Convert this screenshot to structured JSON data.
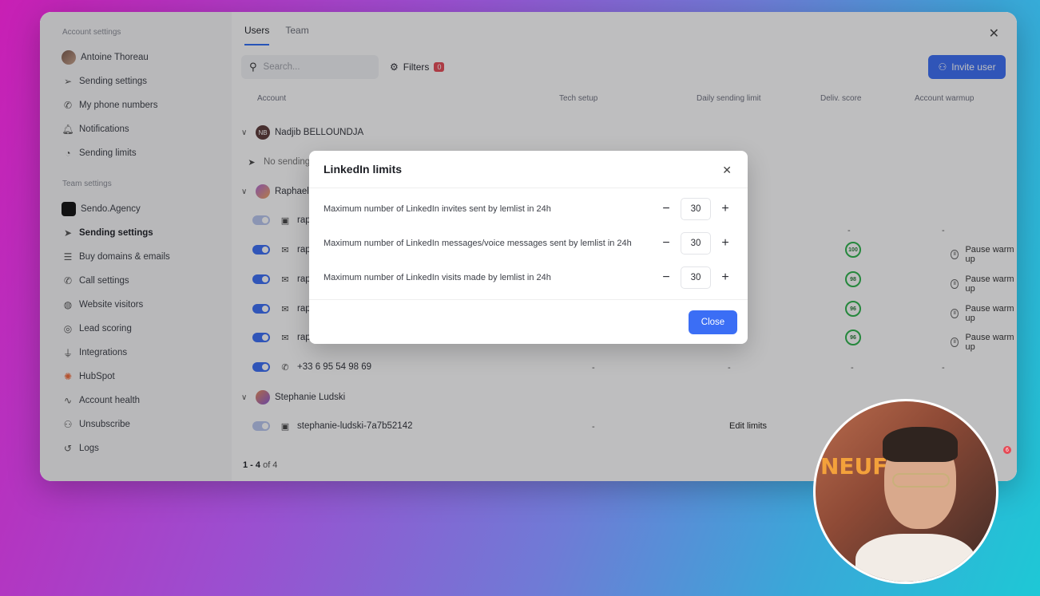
{
  "sidebar": {
    "account_section": "Account settings",
    "account_items": [
      {
        "label": "Antoine Thoreau",
        "icon": "avatar"
      },
      {
        "label": "Sending settings",
        "icon": "send-icon"
      },
      {
        "label": "My phone numbers",
        "icon": "phone-icon"
      },
      {
        "label": "Notifications",
        "icon": "bell-icon"
      },
      {
        "label": "Sending limits",
        "icon": "gauge-icon"
      }
    ],
    "team_section": "Team settings",
    "team_items": [
      {
        "label": "Sendo.Agency",
        "icon": "logo"
      },
      {
        "label": "Sending settings",
        "icon": "send-icon"
      },
      {
        "label": "Buy domains & emails",
        "icon": "server-icon"
      },
      {
        "label": "Call settings",
        "icon": "phone-icon"
      },
      {
        "label": "Website visitors",
        "icon": "globe-icon"
      },
      {
        "label": "Lead scoring",
        "icon": "target-icon"
      },
      {
        "label": "Integrations",
        "icon": "plug-icon"
      },
      {
        "label": "HubSpot",
        "icon": "hubspot-icon"
      },
      {
        "label": "Account health",
        "icon": "pulse-icon"
      },
      {
        "label": "Unsubscribe",
        "icon": "user-x-icon"
      },
      {
        "label": "Logs",
        "icon": "history-icon"
      }
    ]
  },
  "main": {
    "tabs": [
      "Users",
      "Team"
    ],
    "search_placeholder": "Search...",
    "filters_label": "Filters",
    "filters_count": "0",
    "invite_label": "Invite user",
    "columns": [
      "Account",
      "Tech setup",
      "Daily sending limit",
      "Deliv. score",
      "Account warmup"
    ],
    "users": [
      {
        "name": "Nadjib BELLOUNDJA",
        "initials": "NB"
      },
      {
        "name": "Raphael"
      },
      {
        "name": "Stephanie Ludski"
      }
    ],
    "no_sending": "No sending",
    "phone": "+33 6 95 54 98 69",
    "stephanie_account": "stephanie-ludski-7a7b52142",
    "edit_limits": "Edit limits",
    "dash": "-",
    "row_prefix": "rap",
    "scores": [
      "100",
      "98",
      "96",
      "96"
    ],
    "pause_label": "Pause warm up",
    "pagination_range": "1 - 4",
    "pagination_total": "of 4"
  },
  "modal": {
    "title": "LinkedIn limits",
    "limits": [
      {
        "label": "Maximum number of LinkedIn invites sent by lemlist in 24h",
        "value": "30"
      },
      {
        "label": "Maximum number of LinkedIn messages/voice messages sent by lemlist in 24h",
        "value": "30"
      },
      {
        "label": "Maximum number of LinkedIn visits made by lemlist in 24h",
        "value": "30"
      }
    ],
    "close_label": "Close"
  },
  "webcam": {
    "sign_text": "NEUF"
  },
  "notification_count": "6",
  "colors": {
    "accent": "#3b6ef5",
    "badge": "#e64a55",
    "score_ring": "#2bb34a"
  }
}
